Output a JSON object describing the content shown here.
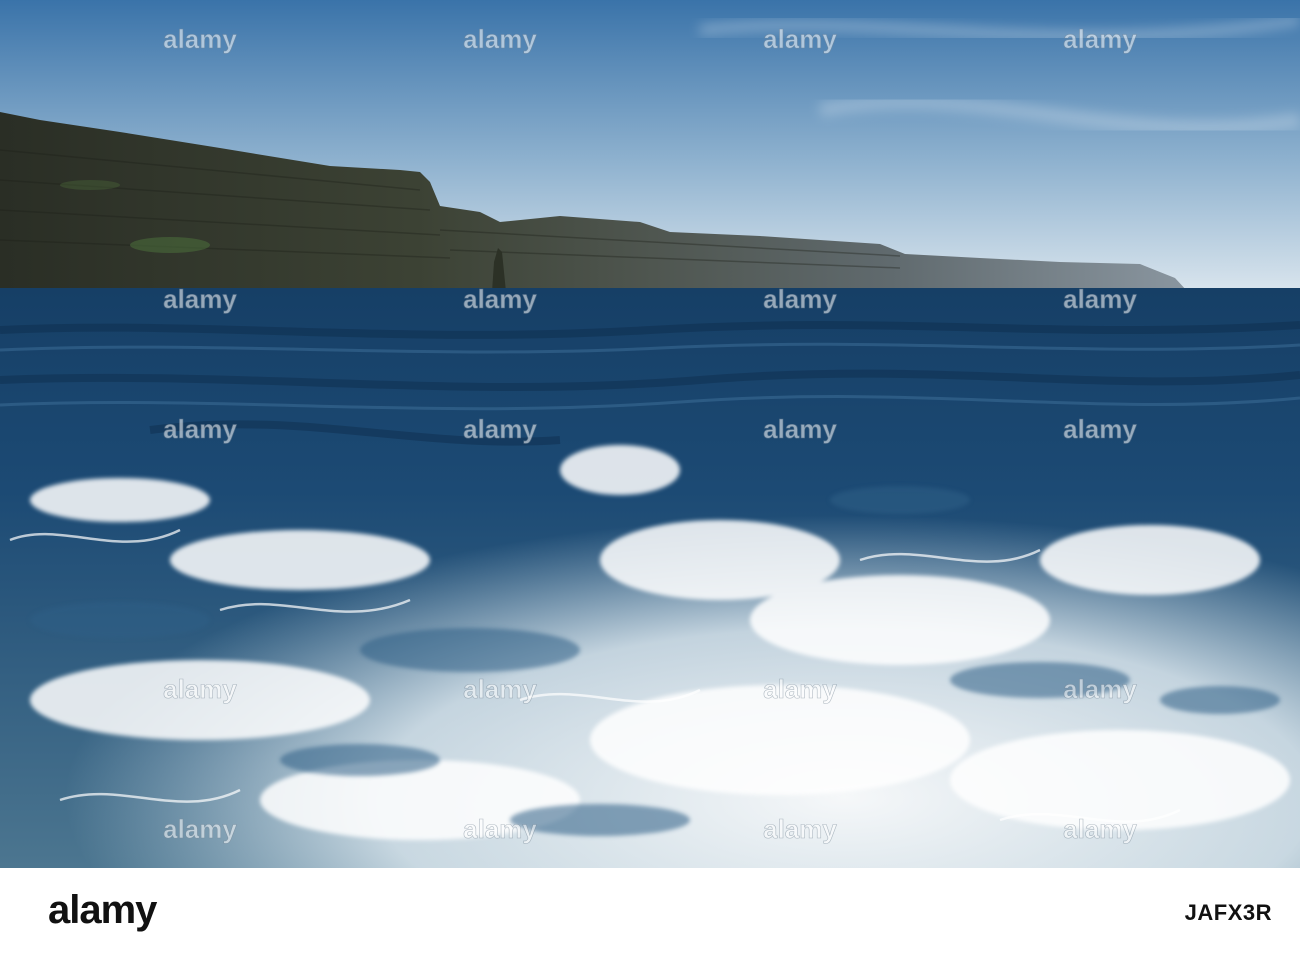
{
  "image": {
    "subject": "Sea cliffs seen from a boat, with white foamy wake in the foreground",
    "colors": {
      "sky_top": "#3f78ad",
      "sky_bottom": "#d5e1ea",
      "cliff_dark": "#2b2f26",
      "cliff_mid": "#3f4638",
      "cliff_far": "#7d8790",
      "sea_deep": "#0f3356",
      "sea_mid": "#1f4d78",
      "foam": "#f2f7fa"
    }
  },
  "watermark": {
    "brand_text": "alamy",
    "repeat_count": 20
  },
  "footer": {
    "brand": "alamy",
    "image_id": "JAFX3R",
    "background": "#ffffff",
    "text_color": "#111111"
  }
}
